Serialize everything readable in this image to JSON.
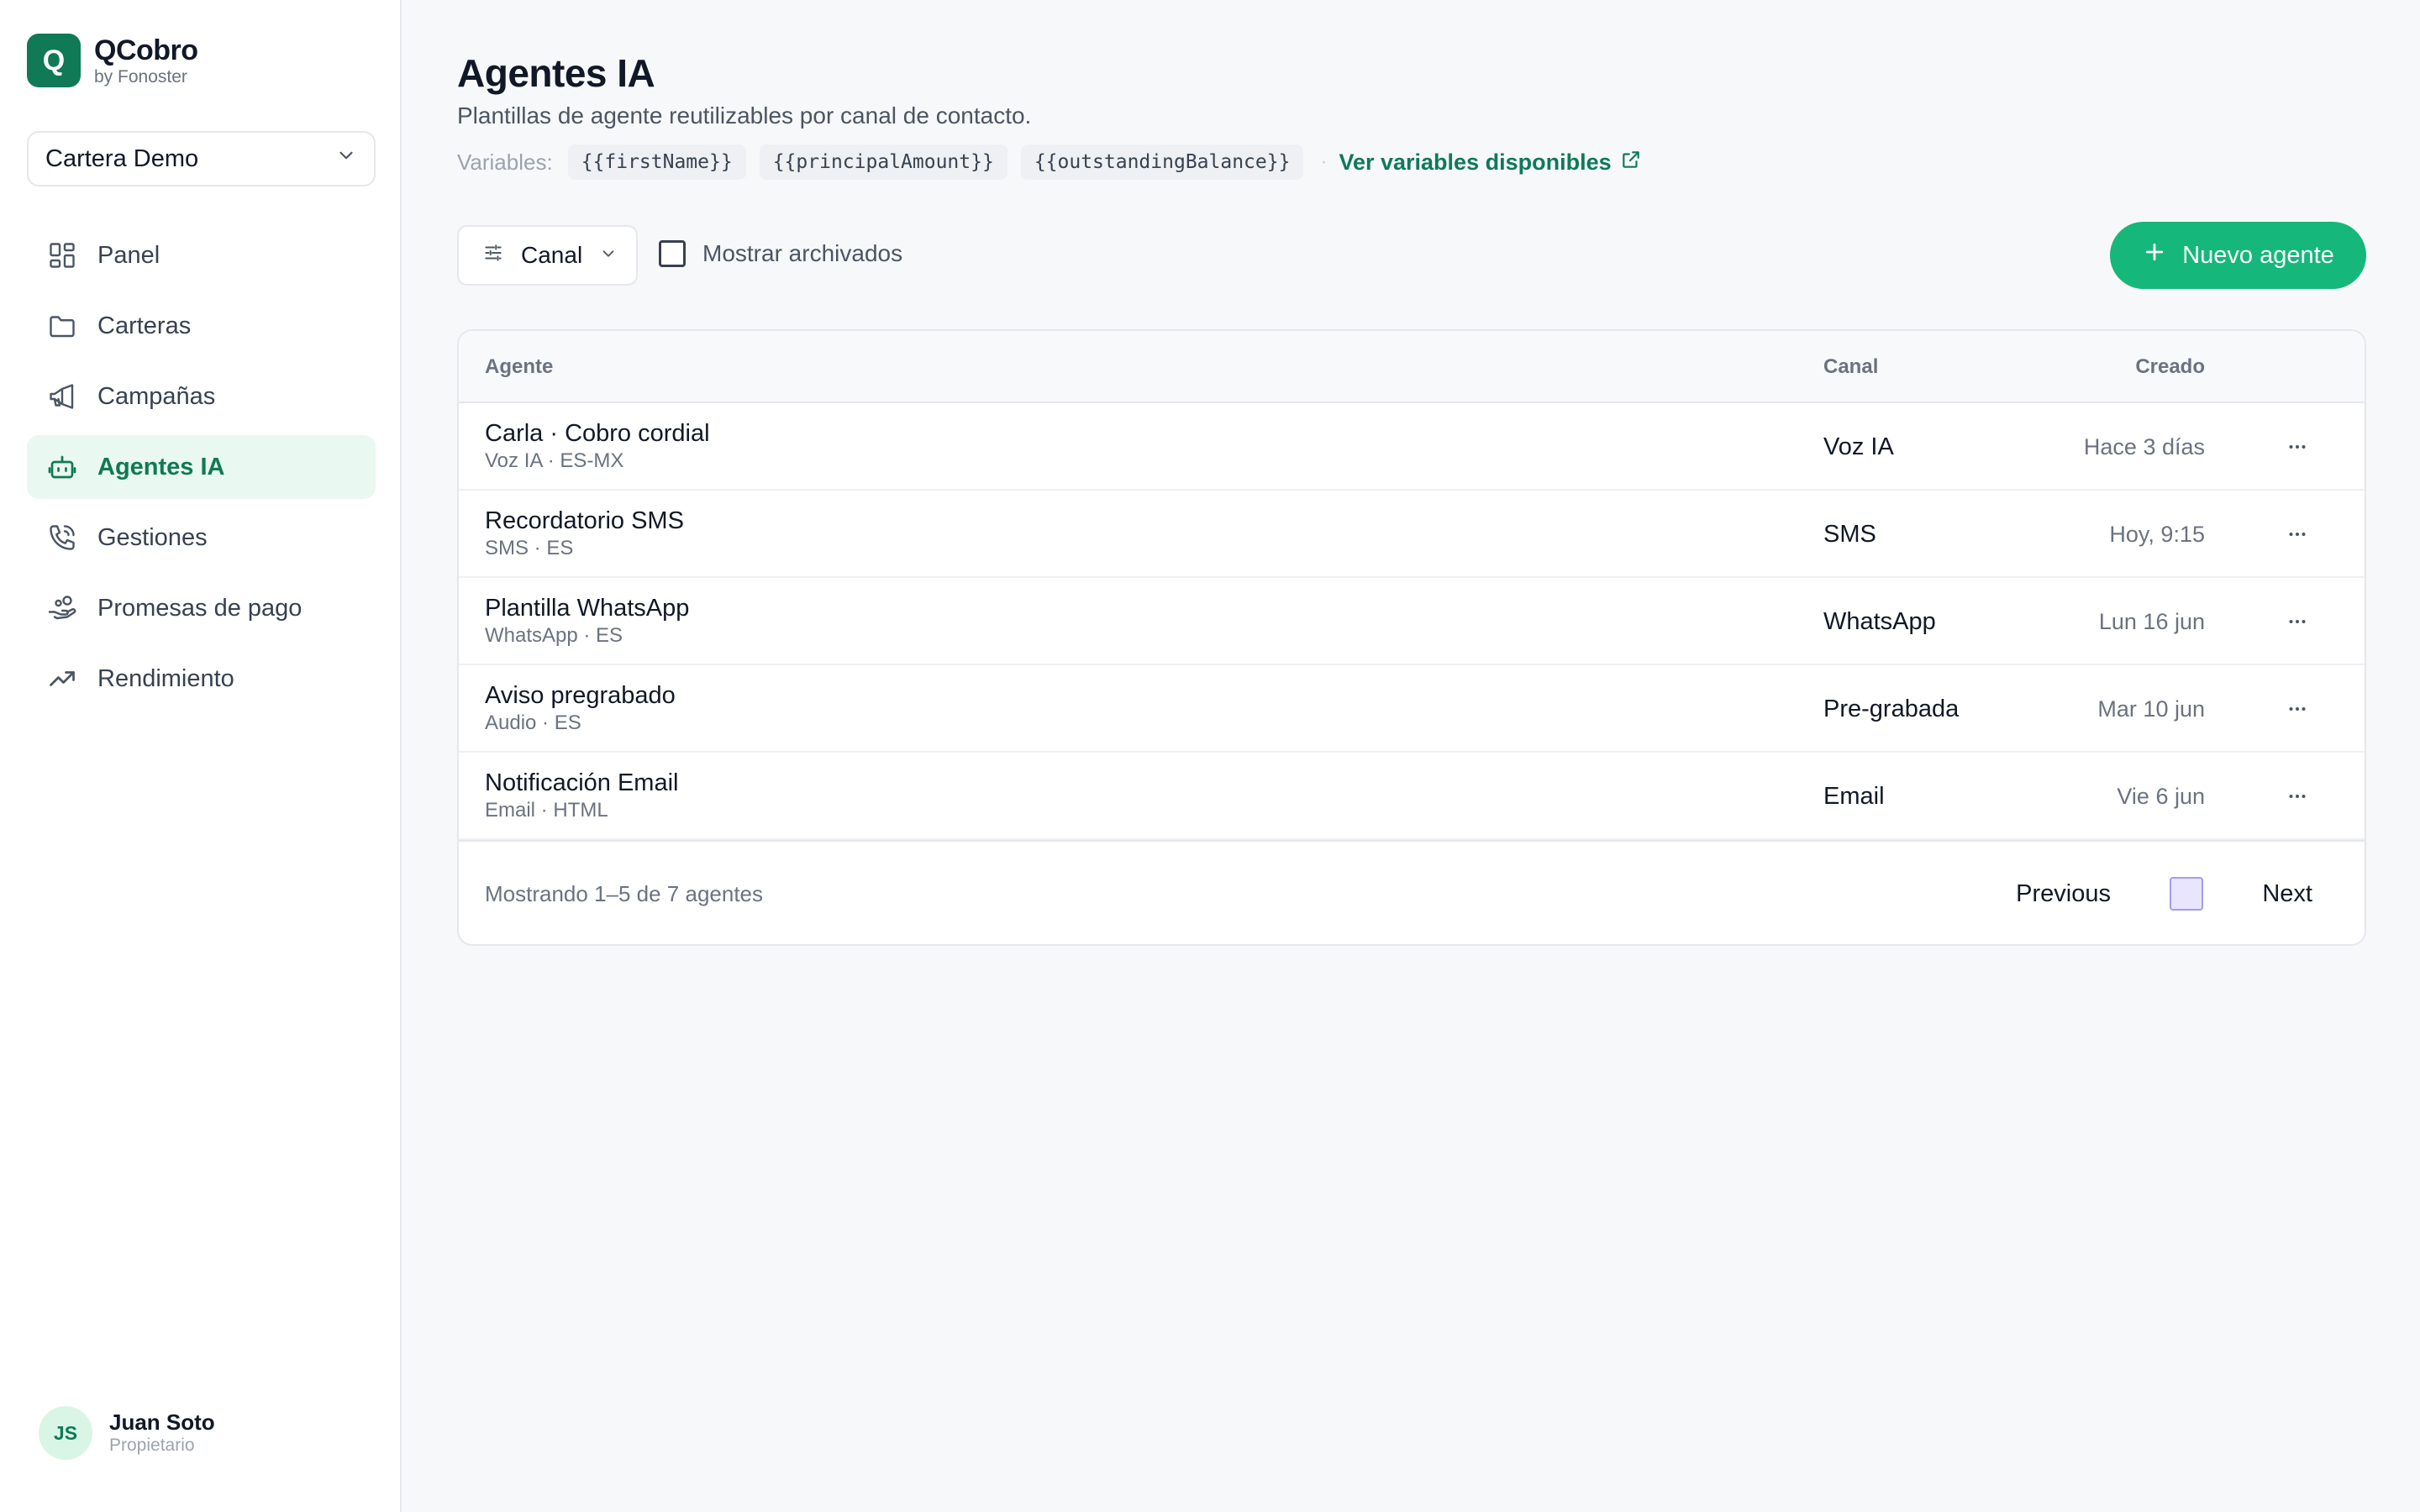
{
  "brand": {
    "logo_letter": "Q",
    "name": "QCobro",
    "sub": "by Fonoster"
  },
  "portfolio": {
    "selected": "Cartera Demo"
  },
  "nav": {
    "items": [
      {
        "label": "Panel",
        "icon": "dashboard-icon"
      },
      {
        "label": "Carteras",
        "icon": "folder-icon"
      },
      {
        "label": "Campañas",
        "icon": "megaphone-icon"
      },
      {
        "label": "Agentes IA",
        "icon": "bot-icon",
        "active": true
      },
      {
        "label": "Gestiones",
        "icon": "phone-icon"
      },
      {
        "label": "Promesas de pago",
        "icon": "hand-coins-icon"
      },
      {
        "label": "Rendimiento",
        "icon": "trending-up-icon"
      }
    ]
  },
  "user": {
    "initials": "JS",
    "name": "Juan Soto",
    "role": "Propietario"
  },
  "header": {
    "title": "Agentes IA",
    "subtitle": "Plantillas de agente reutilizables por canal de contacto.",
    "variables_label": "Variables:",
    "variables": [
      "{{firstName}}",
      "{{principalAmount}}",
      "{{outstandingBalance}}"
    ],
    "separator": "·",
    "variables_link": "Ver variables disponibles"
  },
  "toolbar": {
    "filter_label": "Canal",
    "archived_label": "Mostrar archivados",
    "archived_checked": false,
    "new_button": "Nuevo agente"
  },
  "table": {
    "columns": {
      "agent": "Agente",
      "canal": "Canal",
      "created": "Creado"
    },
    "rows": [
      {
        "name": "Carla · Cobro cordial",
        "meta": "Voz IA · ES-MX",
        "canal": "Voz IA",
        "created": "Hace 3 días"
      },
      {
        "name": "Recordatorio SMS",
        "meta": "SMS · ES",
        "canal": "SMS",
        "created": "Hoy, 9:15"
      },
      {
        "name": "Plantilla WhatsApp",
        "meta": "WhatsApp · ES",
        "canal": "WhatsApp",
        "created": "Lun 16 jun"
      },
      {
        "name": "Aviso pregrabado",
        "meta": "Audio · ES",
        "canal": "Pre-grabada",
        "created": "Mar 10 jun"
      },
      {
        "name": "Notificación Email",
        "meta": "Email · HTML",
        "canal": "Email",
        "created": "Vie 6 jun"
      }
    ],
    "footer": {
      "info": "Mostrando 1–5 de 7 agentes",
      "previous": "Previous",
      "next": "Next"
    }
  },
  "colors": {
    "accent": "#15b87a",
    "brand": "#0f7a55",
    "active_bg": "#e9f8f0"
  }
}
